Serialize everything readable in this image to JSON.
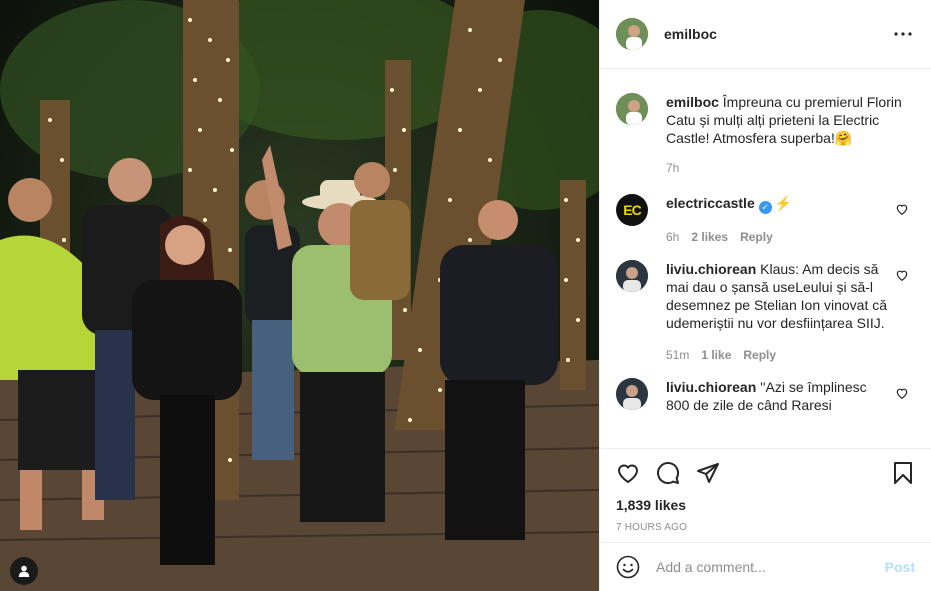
{
  "post": {
    "username": "emilboc",
    "caption_user": "emilboc",
    "caption": "Împreuna cu premierul Florin Catu și mulți alți prieteni la Electric Castle! Atmosfera superba!🤗",
    "caption_time": "7h",
    "likes": "1,839 likes",
    "posted_ago": "7 HOURS AGO"
  },
  "comments": [
    {
      "user": "electriccastle",
      "text": "",
      "time": "6h",
      "likes": "2 likes",
      "reply": "Reply",
      "avatar_text": "EC",
      "verified": true
    },
    {
      "user": "liviu.chiorean",
      "text": "Klaus: Am decis să mai dau o șansă useLeului și să-l desemnez pe Stelian Ion vinovat că udemeriștii nu vor desființarea SIIJ.",
      "time": "51m",
      "likes": "1 like",
      "reply": "Reply"
    },
    {
      "user": "liviu.chiorean",
      "text": "''Azi se împlinesc 800 de zile de când Raresi"
    }
  ],
  "composer": {
    "placeholder": "Add a comment...",
    "post_label": "Post"
  },
  "icons": {
    "more": "more-options-icon",
    "like": "heart-icon",
    "comment": "comment-icon",
    "share": "share-icon",
    "save": "bookmark-icon",
    "emoji": "emoji-icon",
    "tag": "user-tag-icon"
  },
  "colors": {
    "accent": "#3897f0",
    "post_disabled": "#b2dffc",
    "muted": "#8e8e8e"
  }
}
